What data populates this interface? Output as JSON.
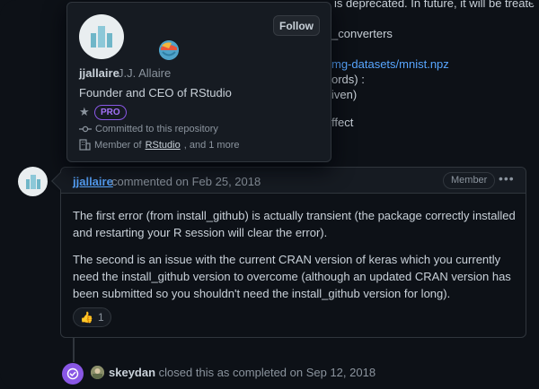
{
  "background_comment": {
    "line1": "is deprecated. In future, it will be treated as",
    "line2": "_converters",
    "line3_link": "mg-datasets/mnist.npz",
    "line4": "ords) :",
    "line5": "iven)",
    "line6": "ffect"
  },
  "popover": {
    "login": "jjallaire",
    "name": "J.J. Allaire",
    "bio": "Founder and CEO of RStudio",
    "follow_label": "Follow",
    "pro_label": "PRO",
    "committed_text": "Committed to this repository",
    "member_prefix": "Member of",
    "member_org": "RStudio",
    "member_suffix": ", and 1 more"
  },
  "comment": {
    "author": "jjallaire",
    "meta": "commented on Feb 25, 2018",
    "role_badge": "Member",
    "more_label": "•••",
    "paragraphs": [
      "The first error (from install_github) is actually transient (the package correctly installed and restarting your R session will clear the error).",
      "The second is an issue with the current CRAN version of keras which you currently need the install_github version to overcome (although an updated CRAN version has been submitted so you shouldn't need the install_github version for long)."
    ],
    "reaction": {
      "emoji": "👍",
      "count": "1"
    }
  },
  "event": {
    "actor": "skeydan",
    "text": "closed this as completed on Sep 12, 2018"
  },
  "colors": {
    "background": "#0d1117",
    "link": "#58a6ff",
    "closed_purple": "#8957e5"
  }
}
